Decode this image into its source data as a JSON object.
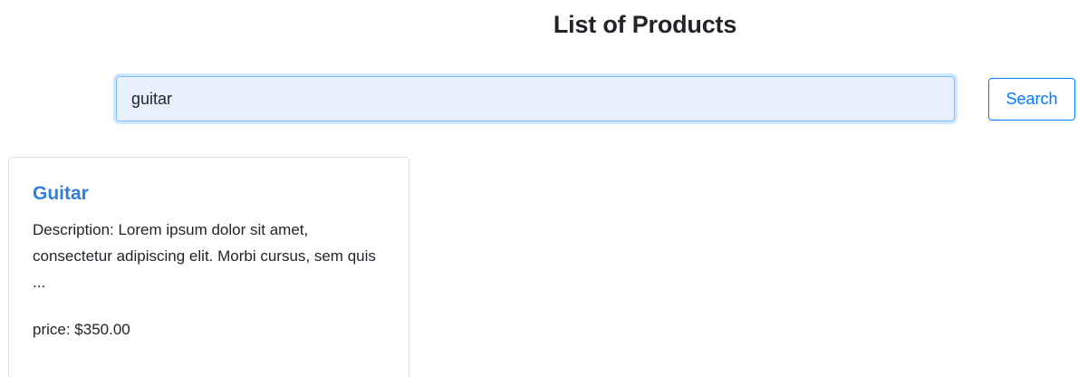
{
  "page": {
    "title": "List of Products"
  },
  "search": {
    "value": "guitar",
    "button_label": "Search"
  },
  "products": [
    {
      "name": "Guitar",
      "description": "Description: Lorem ipsum dolor sit amet, consectetur adipiscing elit. Morbi cursus, sem quis ...",
      "price": "price: $350.00"
    }
  ],
  "colors": {
    "accent": "#007bff",
    "link": "#2f7ee0",
    "input_background": "#e8f0fe",
    "input_focus_border": "#80bdff"
  }
}
